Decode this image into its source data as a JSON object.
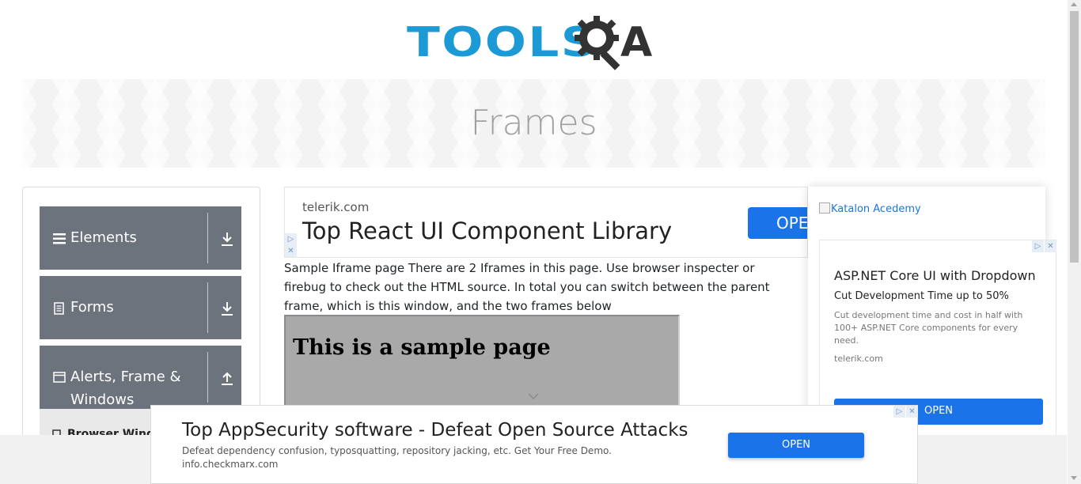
{
  "logo": {
    "text": "TOOLS",
    "text_end": "A",
    "icon": "gear-magnifier-icon",
    "colors": {
      "blue": "#1b9ad6",
      "dark": "#333333"
    }
  },
  "banner": {
    "title": "Frames"
  },
  "sidebar": {
    "groups": [
      {
        "label": "Elements",
        "icon": "hamburger-icon",
        "toggle_icon": "download-arrow-icon"
      },
      {
        "label": "Forms",
        "icon": "document-icon",
        "toggle_icon": "download-arrow-icon"
      },
      {
        "label": "Alerts, Frame &",
        "label2": "Windows",
        "icon": "window-icon",
        "toggle_icon": "upload-arrow-icon"
      }
    ],
    "sub_item": "Browser Windows"
  },
  "ad_top": {
    "domain": "telerik.com",
    "headline": "Top React UI Component Library",
    "open": "OPEN"
  },
  "intro": "Sample Iframe page There are 2 Iframes in this page. Use browser inspecter or firebug to check out the HTML source. In total you can switch between the parent frame, which is this window, and the two frames below",
  "frame1": {
    "heading": "This is a sample page"
  },
  "right_ad": {
    "katalon": "Katalon Acedemy",
    "title": "ASP.NET Core UI with Dropdown",
    "subtitle": "Cut Development Time up to 50%",
    "body": "Cut development time and cost in half with 100+ ASP.NET Core components for every need.",
    "domain": "telerik.com",
    "open": "OPEN"
  },
  "bottom_ad": {
    "headline": "Top AppSecurity software - Defeat Open Source Attacks",
    "desc": "Defeat dependency confusion, typosquatting, repository jacking, etc. Get Your Free Demo.",
    "domain": "info.checkmarx.com",
    "open": "OPEN"
  },
  "colors": {
    "sidebar_group": "#6c737c",
    "accent_button": "#1a73e8"
  }
}
